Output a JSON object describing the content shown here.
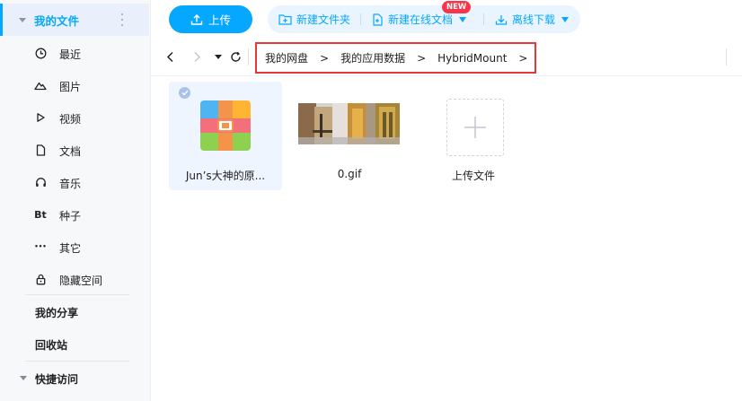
{
  "toolbar": {
    "upload_label": "上传",
    "new_folder_label": "新建文件夹",
    "new_online_doc_label": "新建在线文档",
    "new_badge": "NEW",
    "offline_download_label": "离线下载"
  },
  "sidebar": {
    "my_files_label": "我的文件",
    "items": [
      {
        "label": "最近",
        "icon": "clock-icon"
      },
      {
        "label": "图片",
        "icon": "mountain-icon"
      },
      {
        "label": "视频",
        "icon": "play-icon"
      },
      {
        "label": "文档",
        "icon": "document-icon"
      },
      {
        "label": "音乐",
        "icon": "headphones-icon"
      },
      {
        "label": "种子",
        "icon": "bt-icon",
        "glyph": "Bt"
      },
      {
        "label": "其它",
        "icon": "more-icon",
        "glyph": "•••"
      },
      {
        "label": "隐藏空间",
        "icon": "lock-icon"
      }
    ],
    "my_share_label": "我的分享",
    "recycle_label": "回收站",
    "quick_access_label": "快捷访问"
  },
  "breadcrumb": {
    "items": [
      "我的网盘",
      "我的应用数据",
      "HybridMount"
    ],
    "separator": ">"
  },
  "files": [
    {
      "name": "Jun’s大神的原...",
      "type": "zip",
      "selected": true
    },
    {
      "name": "0.gif",
      "type": "gif",
      "selected": false
    }
  ],
  "upload_tile_label": "上传文件",
  "colors": {
    "accent": "#06a7ff",
    "highlight_border": "#e5383b",
    "new_badge": "#f5364b"
  }
}
